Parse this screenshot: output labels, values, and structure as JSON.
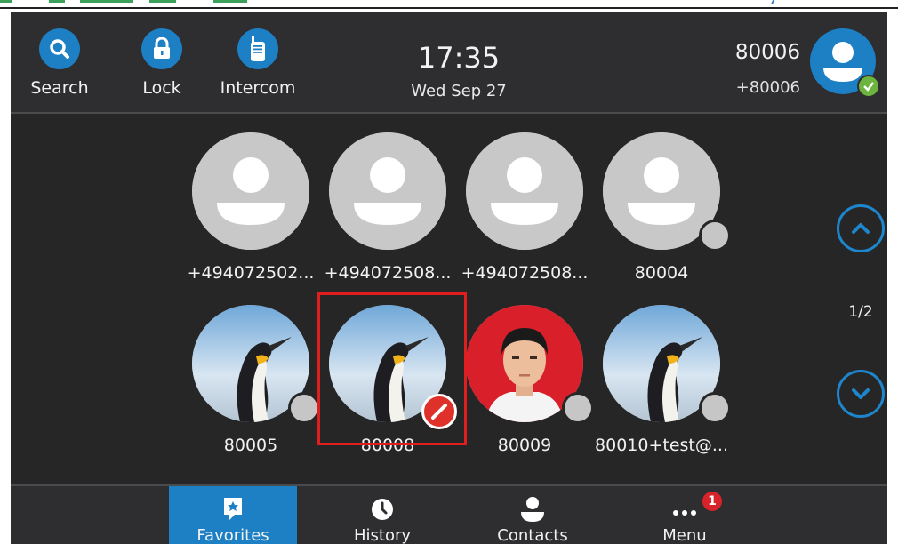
{
  "status_bar": {
    "tools": [
      {
        "label": "Search",
        "icon": "search-icon"
      },
      {
        "label": "Lock",
        "icon": "lock-icon"
      },
      {
        "label": "Intercom",
        "icon": "intercom-icon"
      }
    ],
    "time": "17:35",
    "date": "Wed Sep 27",
    "account_number": "80006",
    "account_sub": "+80006",
    "account_status": "registered"
  },
  "contacts": [
    {
      "label": "+494072502...",
      "avatar": "default-avatar",
      "presence": "none"
    },
    {
      "label": "+494072508...",
      "avatar": "default-avatar",
      "presence": "none"
    },
    {
      "label": "+494072508...",
      "avatar": "default-avatar",
      "presence": "none"
    },
    {
      "label": "80004",
      "avatar": "default-avatar",
      "presence": "offline"
    },
    {
      "label": "80005",
      "avatar": "penguin-photo",
      "presence": "offline"
    },
    {
      "label": "80008",
      "avatar": "penguin-photo",
      "presence": "do-not-disturb",
      "highlighted": true
    },
    {
      "label": "80009",
      "avatar": "person-photo",
      "presence": "offline"
    },
    {
      "label": "80010+test@...",
      "avatar": "penguin-photo",
      "presence": "offline"
    }
  ],
  "pager": {
    "indicator": "1/2",
    "up_icon": "chevron-up-icon",
    "down_icon": "chevron-down-icon"
  },
  "nav": {
    "tabs": [
      {
        "label": "Favorites",
        "icon": "favorites-icon",
        "active": true
      },
      {
        "label": "History",
        "icon": "history-icon",
        "active": false
      },
      {
        "label": "Contacts",
        "icon": "contacts-icon",
        "active": false
      },
      {
        "label": "Menu",
        "icon": "menu-dots-icon",
        "active": false,
        "badge": "1"
      }
    ]
  },
  "colors": {
    "accent": "#1d7fc4",
    "background": "#262627",
    "dnd": "#e0302a",
    "online": "#6cb33f",
    "highlight": "#e01e1e"
  }
}
